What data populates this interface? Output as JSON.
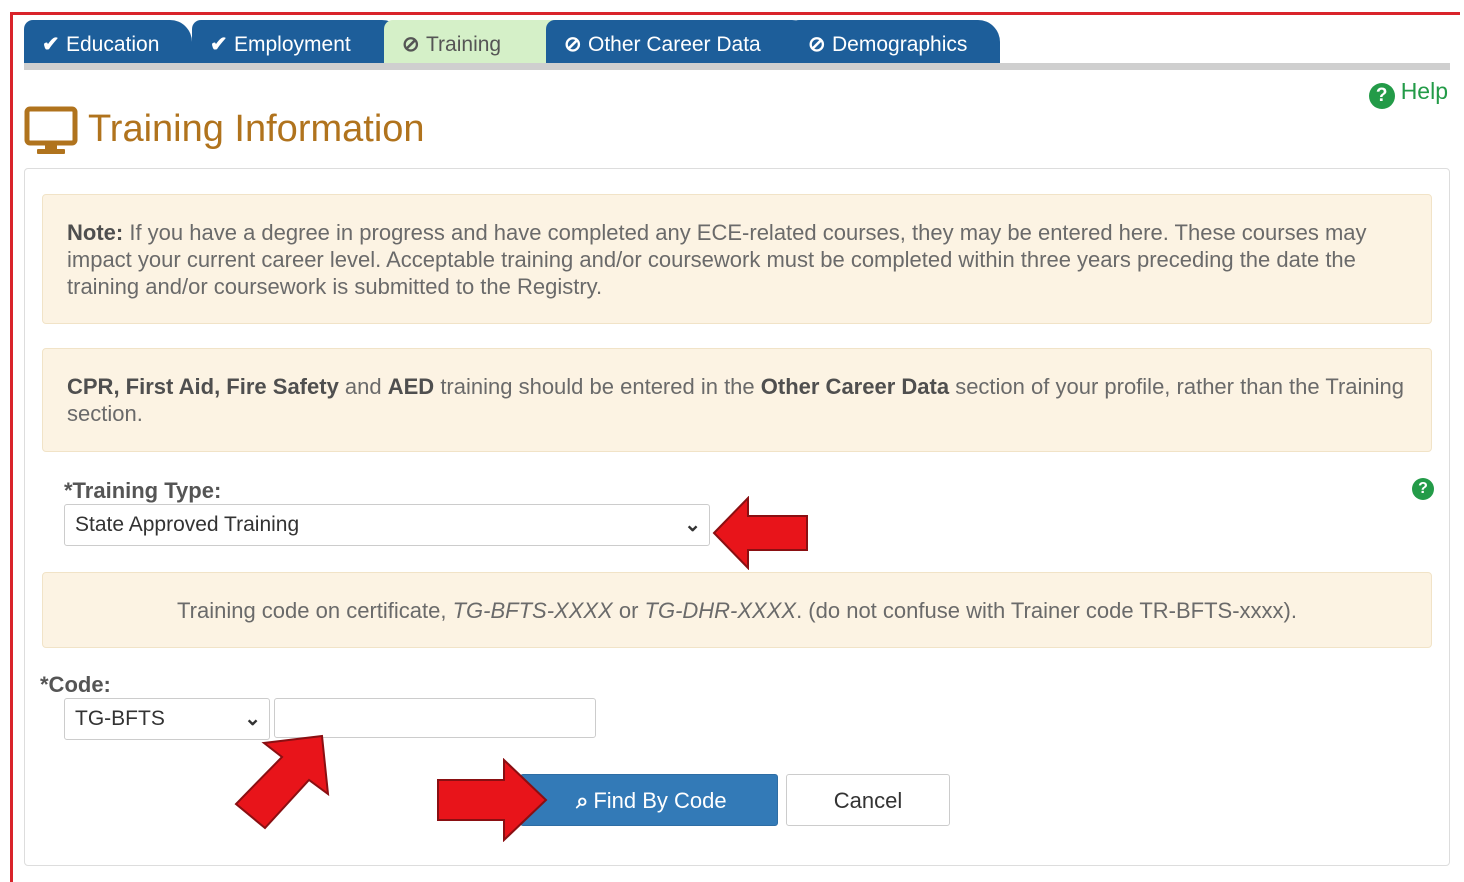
{
  "tabs": [
    {
      "label": "Education",
      "state": "done",
      "icon": "check-icon"
    },
    {
      "label": "Employment",
      "state": "done",
      "icon": "check-icon"
    },
    {
      "label": "Training",
      "state": "active",
      "icon": "ban-icon"
    },
    {
      "label": "Other Career Data",
      "state": "pending",
      "icon": "ban-icon"
    },
    {
      "label": "Demographics",
      "state": "pending",
      "icon": "ban-icon"
    }
  ],
  "help": {
    "label": "Help",
    "icon": "question-circle-icon"
  },
  "page": {
    "title": "Training Information",
    "icon": "monitor-icon"
  },
  "notes": {
    "note1_bold": "Note:",
    "note1_text": " If you have a degree in progress and have completed any ECE-related courses, they may be entered here. These courses may impact your current career level. Acceptable training and/or coursework must be completed within three years preceding the date the training and/or coursework is submitted to the Registry.",
    "note2_b1": "CPR, First Aid, Fire Safety",
    "note2_t1": " and ",
    "note2_b2": "AED",
    "note2_t2": " training should be entered in the ",
    "note2_b3": "Other Career Data",
    "note2_t3": " section of your profile, rather than the Training section.",
    "note3_t1": "Training code on certificate, ",
    "note3_i1": "TG-BFTS-XXXX",
    "note3_t2": " or ",
    "note3_i2": "TG-DHR-XXXX",
    "note3_t3": ". (do not confuse with Trainer code TR-BFTS-xxxx)."
  },
  "training_type": {
    "label": "*Training Type:",
    "value": "State Approved Training"
  },
  "code": {
    "label": "*Code:",
    "prefix_value": "TG-BFTS",
    "input_value": "",
    "input_placeholder": ""
  },
  "buttons": {
    "find": "Find By Code",
    "cancel": "Cancel"
  },
  "colors": {
    "tab_blue": "#1d5e9a",
    "tab_active": "#d5f0c8",
    "title": "#b0731d",
    "help_green": "#239b48",
    "note_bg": "#fcf3e3",
    "primary": "#337ab7",
    "arrow_red": "#e8141a"
  }
}
